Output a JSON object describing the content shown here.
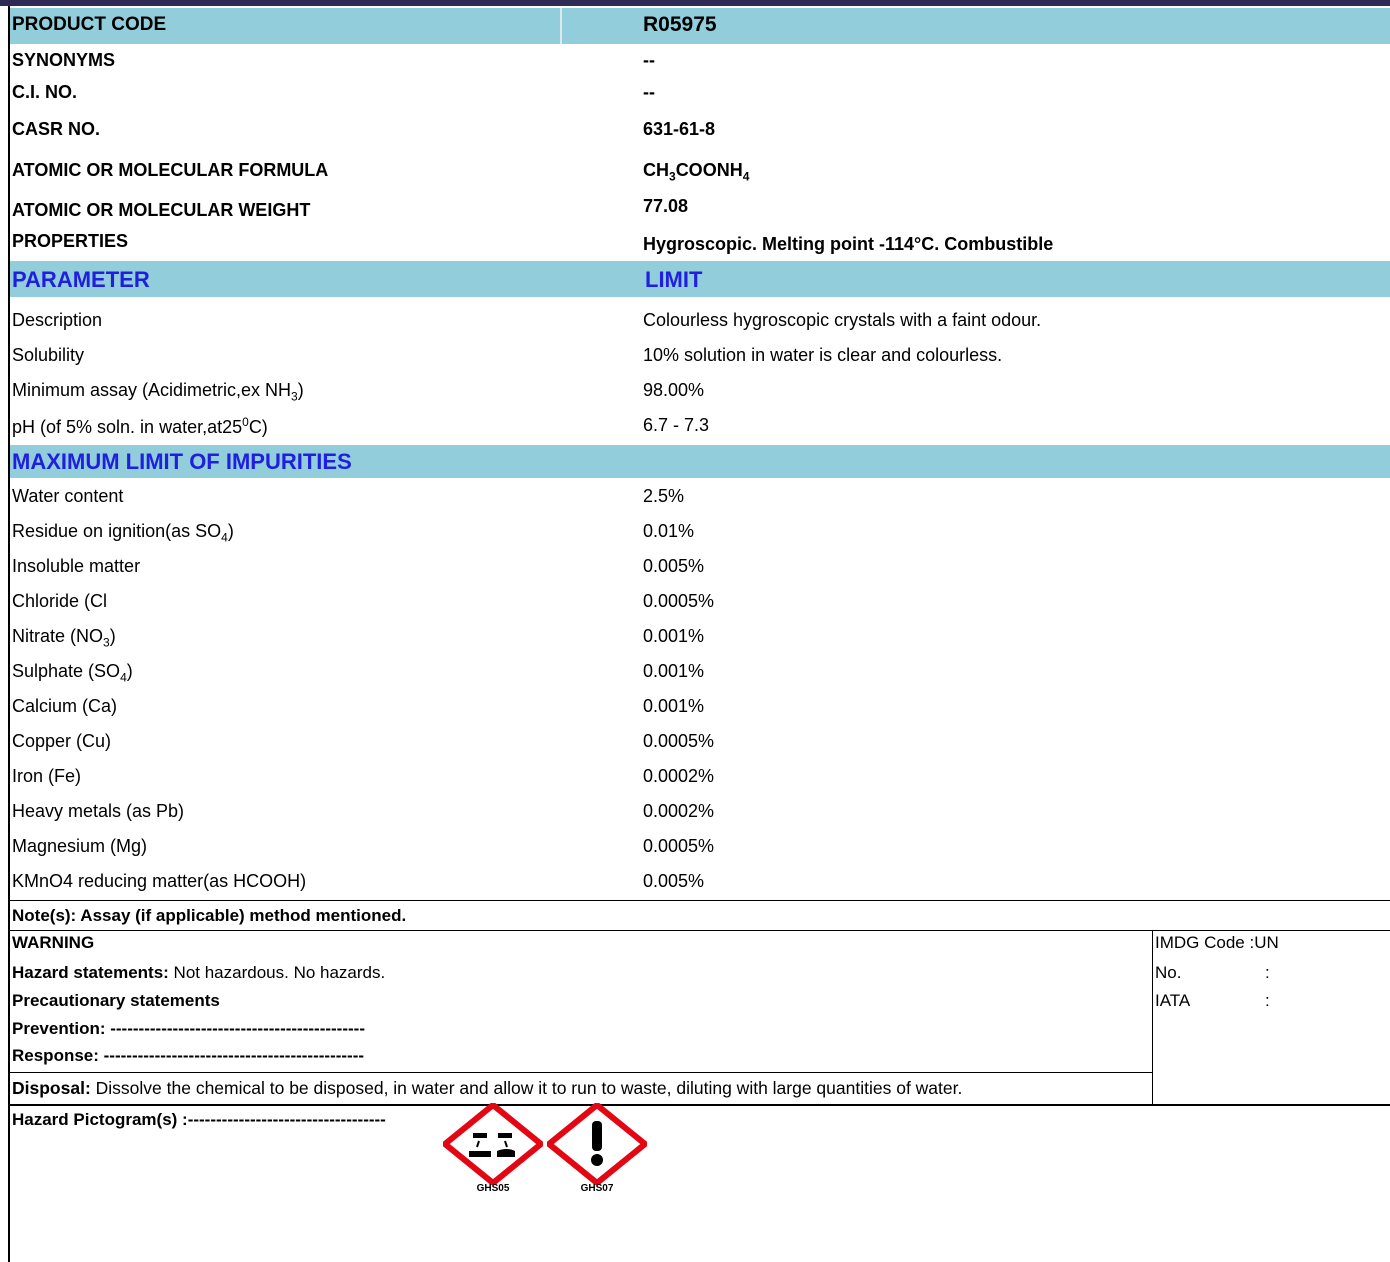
{
  "header": {
    "product_code_label": "PRODUCT CODE",
    "product_code_value": "R05975"
  },
  "info": [
    {
      "label": "SYNONYMS",
      "value": "--"
    },
    {
      "label": "C.I. NO.",
      "value": "--"
    },
    {
      "label": "CASR NO.",
      "value": "631-61-8"
    },
    {
      "label": "ATOMIC OR MOLECULAR FORMULA",
      "value_parts": [
        "CH",
        "3",
        "COONH",
        "4"
      ]
    },
    {
      "label": "ATOMIC OR MOLECULAR WEIGHT",
      "value": "77.08"
    },
    {
      "label": "PROPERTIES",
      "value": "Hygroscopic. Melting point -114°C. Combustible"
    }
  ],
  "parameter_header": {
    "param": "PARAMETER",
    "limit": "LIMIT"
  },
  "parameters": [
    {
      "name": "Description",
      "limit": "Colourless hygroscopic crystals with a faint odour."
    },
    {
      "name": "Solubility",
      "limit": "10% solution in water is clear and colourless."
    },
    {
      "name_parts": [
        "Minimum assay (Acidimetric,ex NH",
        "3",
        ")"
      ],
      "limit": "98.00%"
    },
    {
      "name_parts": [
        "pH (of 5% soln. in water,at25",
        "0",
        "C)"
      ],
      "limit": "6.7 - 7.3"
    }
  ],
  "impurities_header": "MAXIMUM LIMIT OF IMPURITIES",
  "impurities": [
    {
      "name": "Water content",
      "limit": "2.5%"
    },
    {
      "name_parts": [
        "Residue on ignition(as SO",
        "4",
        ")"
      ],
      "limit": "0.01%"
    },
    {
      "name": "Insoluble matter",
      "limit": "0.005%"
    },
    {
      "name": "Chloride (Cl",
      "limit": "0.0005%"
    },
    {
      "name_parts": [
        "Nitrate (NO",
        "3",
        ")"
      ],
      "limit": "0.001%"
    },
    {
      "name_parts": [
        "Sulphate (SO",
        "4",
        ")"
      ],
      "limit": "0.001%"
    },
    {
      "name": "Calcium (Ca)",
      "limit": "0.001%"
    },
    {
      "name": "Copper (Cu)",
      "limit": "0.0005%"
    },
    {
      "name": "Iron (Fe)",
      "limit": "0.0002%"
    },
    {
      "name": "Heavy metals (as Pb)",
      "limit": "0.0002%"
    },
    {
      "name": "Magnesium (Mg)",
      "limit": "0.0005%"
    },
    {
      "name": "KMnO4 reducing matter(as HCOOH)",
      "limit": "0.005%"
    }
  ],
  "note": "Note(s): Assay (if applicable) method mentioned.",
  "hazard": {
    "warning": "WARNING",
    "hazard_label": "Hazard statements:",
    "hazard_text": " Not hazardous. No hazards.",
    "precautionary": "Precautionary statements",
    "prevention": "Prevention: ---------------------------------------------",
    "response": "Response:  ----------------------------------------------",
    "disposal_label": "Disposal:",
    "disposal_text": " Dissolve the chemical to be disposed, in water and allow it to run to waste, diluting with large quantities of water."
  },
  "transport": {
    "imdg": "IMDG Code :UN",
    "no": "No.",
    "no_colon": ":",
    "iata": "IATA",
    "iata_colon": ":"
  },
  "pictograms": {
    "label": "Hazard Pictogram(s) :-----------------------------------",
    "items": [
      {
        "code": "GHS05",
        "icon": "corrosion-icon"
      },
      {
        "code": "GHS07",
        "icon": "exclamation-icon"
      }
    ],
    "border_color": "#e30613"
  }
}
